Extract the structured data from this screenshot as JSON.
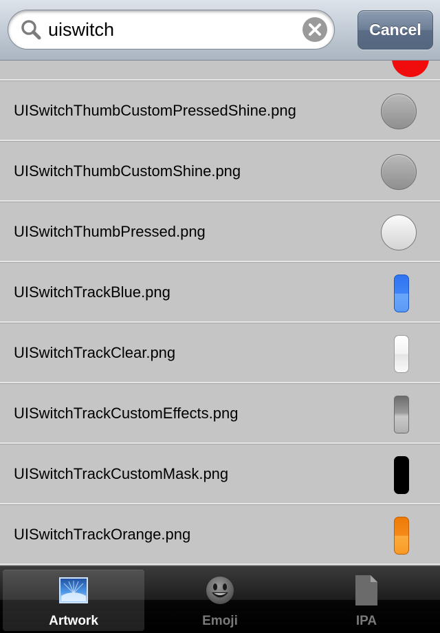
{
  "search": {
    "value": "uiswitch",
    "cancel_label": "Cancel"
  },
  "list": {
    "items": [
      {
        "label": "UISwitchThumbCustomPressedShine.png",
        "thumb": "gray-circle"
      },
      {
        "label": "UISwitchThumbCustomShine.png",
        "thumb": "gray-circle"
      },
      {
        "label": "UISwitchThumbPressed.png",
        "thumb": "white-circle"
      },
      {
        "label": "UISwitchTrackBlue.png",
        "thumb": "blue-track"
      },
      {
        "label": "UISwitchTrackClear.png",
        "thumb": "clear-track"
      },
      {
        "label": "UISwitchTrackCustomEffects.png",
        "thumb": "gray-gradient-track"
      },
      {
        "label": "UISwitchTrackCustomMask.png",
        "thumb": "black-track"
      },
      {
        "label": "UISwitchTrackOrange.png",
        "thumb": "orange-track"
      }
    ]
  },
  "tabbar": {
    "tabs": [
      {
        "label": "Artwork",
        "icon": "artwork-icon",
        "selected": true
      },
      {
        "label": "Emoji",
        "icon": "emoji-icon",
        "selected": false
      },
      {
        "label": "IPA",
        "icon": "document-icon",
        "selected": false
      }
    ]
  },
  "colors": {
    "list_background": "#c5c5c5",
    "cancel_button": "#6c7e96",
    "tabbar_background": "#000000"
  }
}
